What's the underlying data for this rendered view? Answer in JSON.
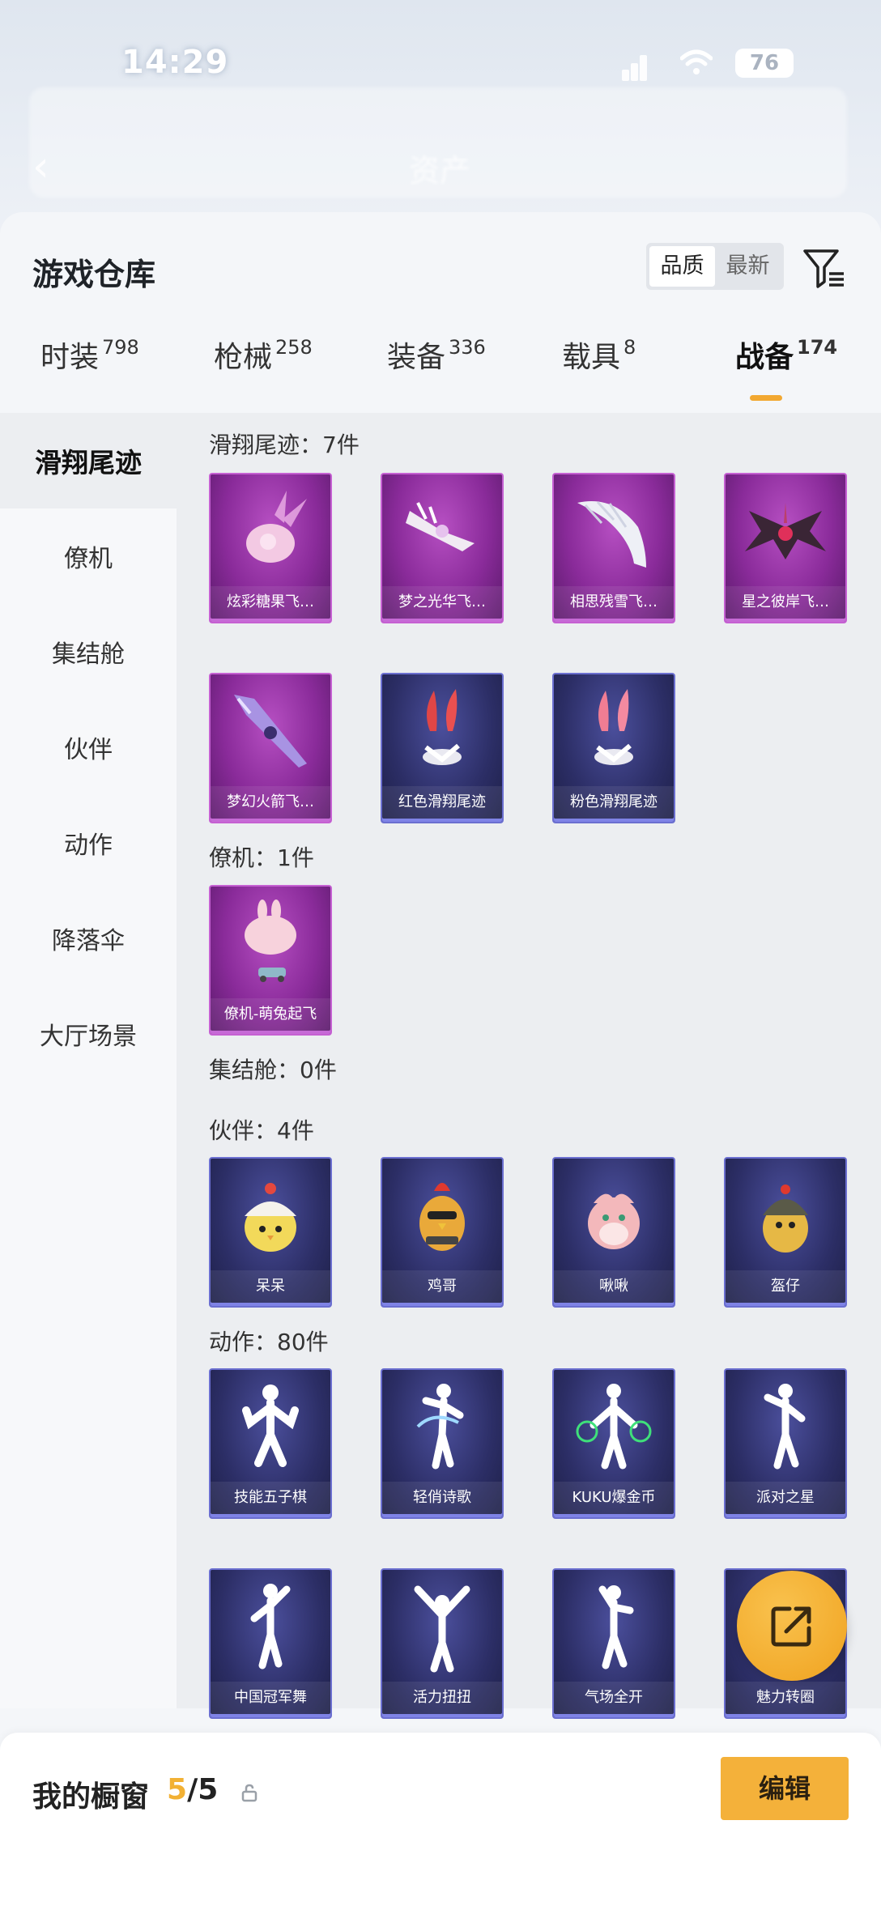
{
  "status_bar": {
    "time": "14:29",
    "battery": "76"
  },
  "background": {
    "title": "资产"
  },
  "sheet": {
    "title": "游戏仓库",
    "sort": {
      "options": [
        "品质",
        "最新"
      ],
      "selected": "品质"
    }
  },
  "tabs": [
    {
      "label": "时装",
      "count": "798"
    },
    {
      "label": "枪械",
      "count": "258"
    },
    {
      "label": "装备",
      "count": "336"
    },
    {
      "label": "载具",
      "count": "8"
    },
    {
      "label": "战备",
      "count": "174",
      "active": true
    }
  ],
  "nav": [
    "滑翔尾迹",
    "僚机",
    "集结舱",
    "伙伴",
    "动作",
    "降落伞",
    "大厅场景"
  ],
  "sections": {
    "glide": {
      "label": "滑翔尾迹：7件",
      "items": [
        "炫彩糖果飞…",
        "梦之光华飞…",
        "相思残雪飞…",
        "星之彼岸飞…",
        "梦幻火箭飞…",
        "红色滑翔尾迹",
        "粉色滑翔尾迹"
      ]
    },
    "wingman": {
      "label": "僚机：1件",
      "items": [
        "僚机-萌兔起飞"
      ]
    },
    "capsule": {
      "label": "集结舱：0件"
    },
    "partner": {
      "label": "伙伴：4件",
      "items": [
        "呆呆",
        "鸡哥",
        "啾啾",
        "盔仔"
      ]
    },
    "emote": {
      "label": "动作：80件",
      "items": [
        "技能五子棋",
        "轻俏诗歌",
        "KUKU爆金币",
        "派对之星",
        "中国冠军舞",
        "活力扭扭",
        "气场全开",
        "魅力转圈"
      ]
    }
  },
  "bottom_bar": {
    "title": "我的橱窗",
    "count_current": "5",
    "count_total": "/5",
    "edit_label": "编辑"
  },
  "colors": {
    "accent": "#f2a831",
    "rare_purple": "#8a2b9a",
    "rare_blue": "#2c2e66"
  }
}
